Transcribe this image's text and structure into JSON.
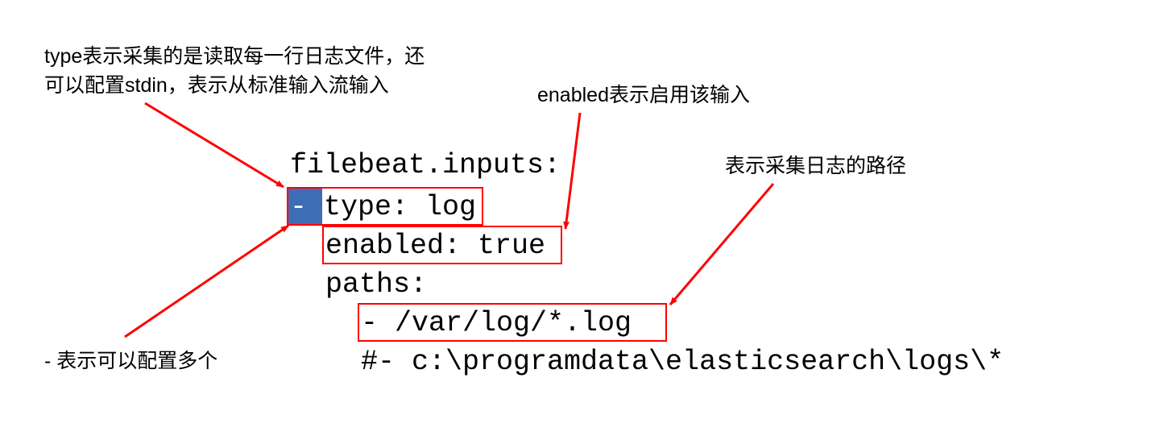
{
  "annotations": {
    "type_note_line1": "type表示采集的是读取每一行日志文件，还",
    "type_note_line2": "可以配置stdin，表示从标准输入流输入",
    "enabled_note": "enabled表示启用该输入",
    "paths_note": "表示采集日志的路径",
    "dash_note": "- 表示可以配置多个"
  },
  "code": {
    "line1": "filebeat.inputs:",
    "line2_dash": "- ",
    "line2_rest": "type: log",
    "line3": "enabled: true",
    "line4": "paths:",
    "line5": "- /var/log/*.log",
    "line6": "#- c:\\programdata\\elasticsearch\\logs\\*"
  }
}
